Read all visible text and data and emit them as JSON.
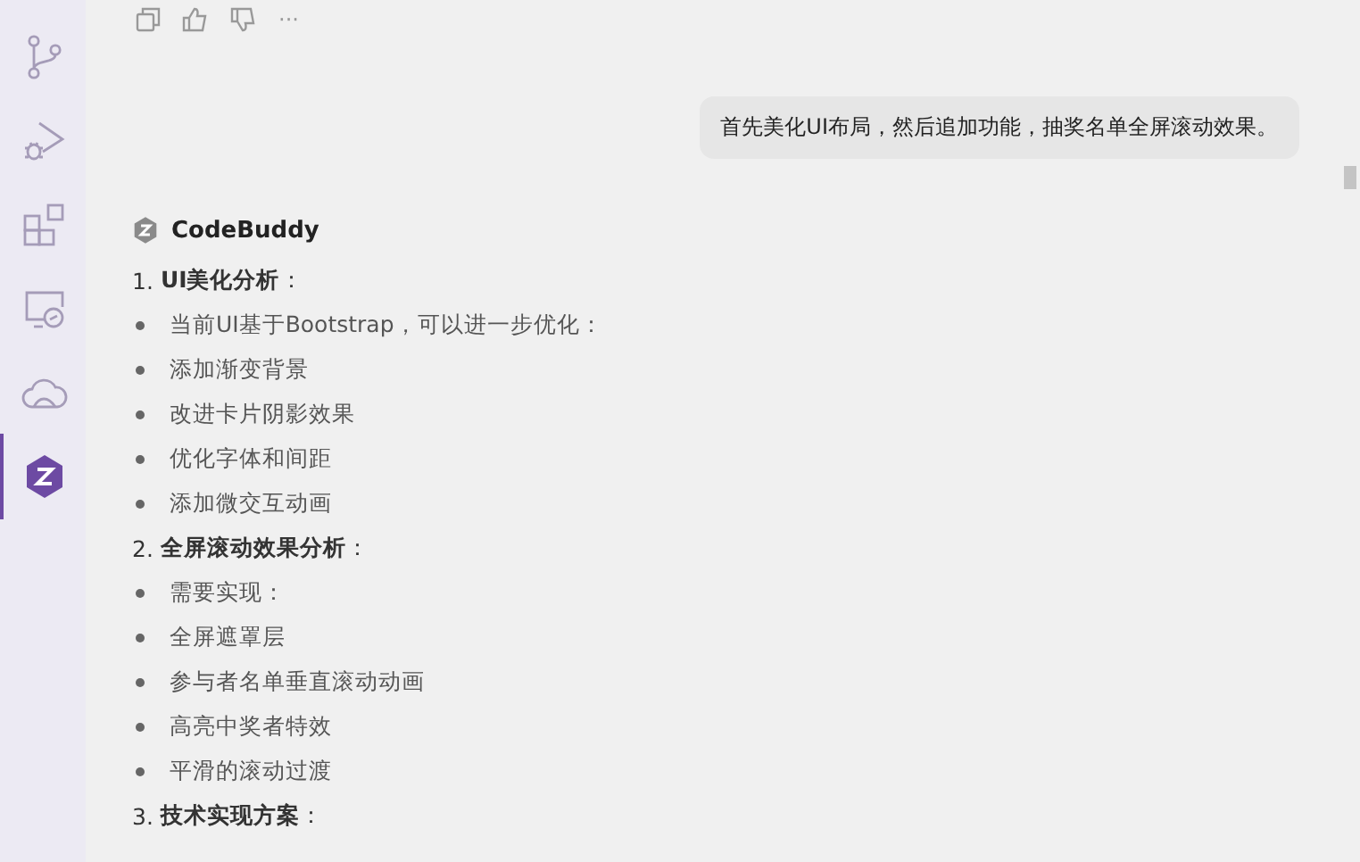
{
  "activity_bar": [
    {
      "kind": "branch",
      "selected": false
    },
    {
      "kind": "debug",
      "selected": false
    },
    {
      "kind": "extensions",
      "selected": false
    },
    {
      "kind": "remote",
      "selected": false
    },
    {
      "kind": "cloud",
      "selected": false
    },
    {
      "kind": "codebuddy",
      "selected": true
    }
  ],
  "message_actions": [
    {
      "kind": "copy"
    },
    {
      "kind": "like"
    },
    {
      "kind": "dislike"
    },
    {
      "kind": "more",
      "text": "···"
    }
  ],
  "user_message": "首先美化UI布局，然后追加功能，抽奖名单全屏滚动效果。",
  "assistant": {
    "name": "CodeBuddy",
    "lines": [
      {
        "kind": "heading",
        "number": "1.",
        "text": "**UI美化分析**："
      },
      {
        "kind": "bullet",
        "text": "当前UI基于Bootstrap，可以进一步优化："
      },
      {
        "kind": "bullet",
        "text": "添加渐变背景"
      },
      {
        "kind": "bullet",
        "text": "改进卡片阴影效果"
      },
      {
        "kind": "bullet",
        "text": "优化字体和间距"
      },
      {
        "kind": "bullet",
        "text": "添加微交互动画"
      },
      {
        "kind": "heading",
        "number": "2.",
        "text": "**全屏滚动效果分析**："
      },
      {
        "kind": "bullet",
        "text": "需要实现："
      },
      {
        "kind": "bullet",
        "text": "全屏遮罩层"
      },
      {
        "kind": "bullet",
        "text": "参与者名单垂直滚动动画"
      },
      {
        "kind": "bullet",
        "text": "高亮中奖者特效"
      },
      {
        "kind": "bullet",
        "text": "平滑的滚动过渡"
      },
      {
        "kind": "heading",
        "number": "3.",
        "text": "**技术实现方案**："
      }
    ]
  }
}
